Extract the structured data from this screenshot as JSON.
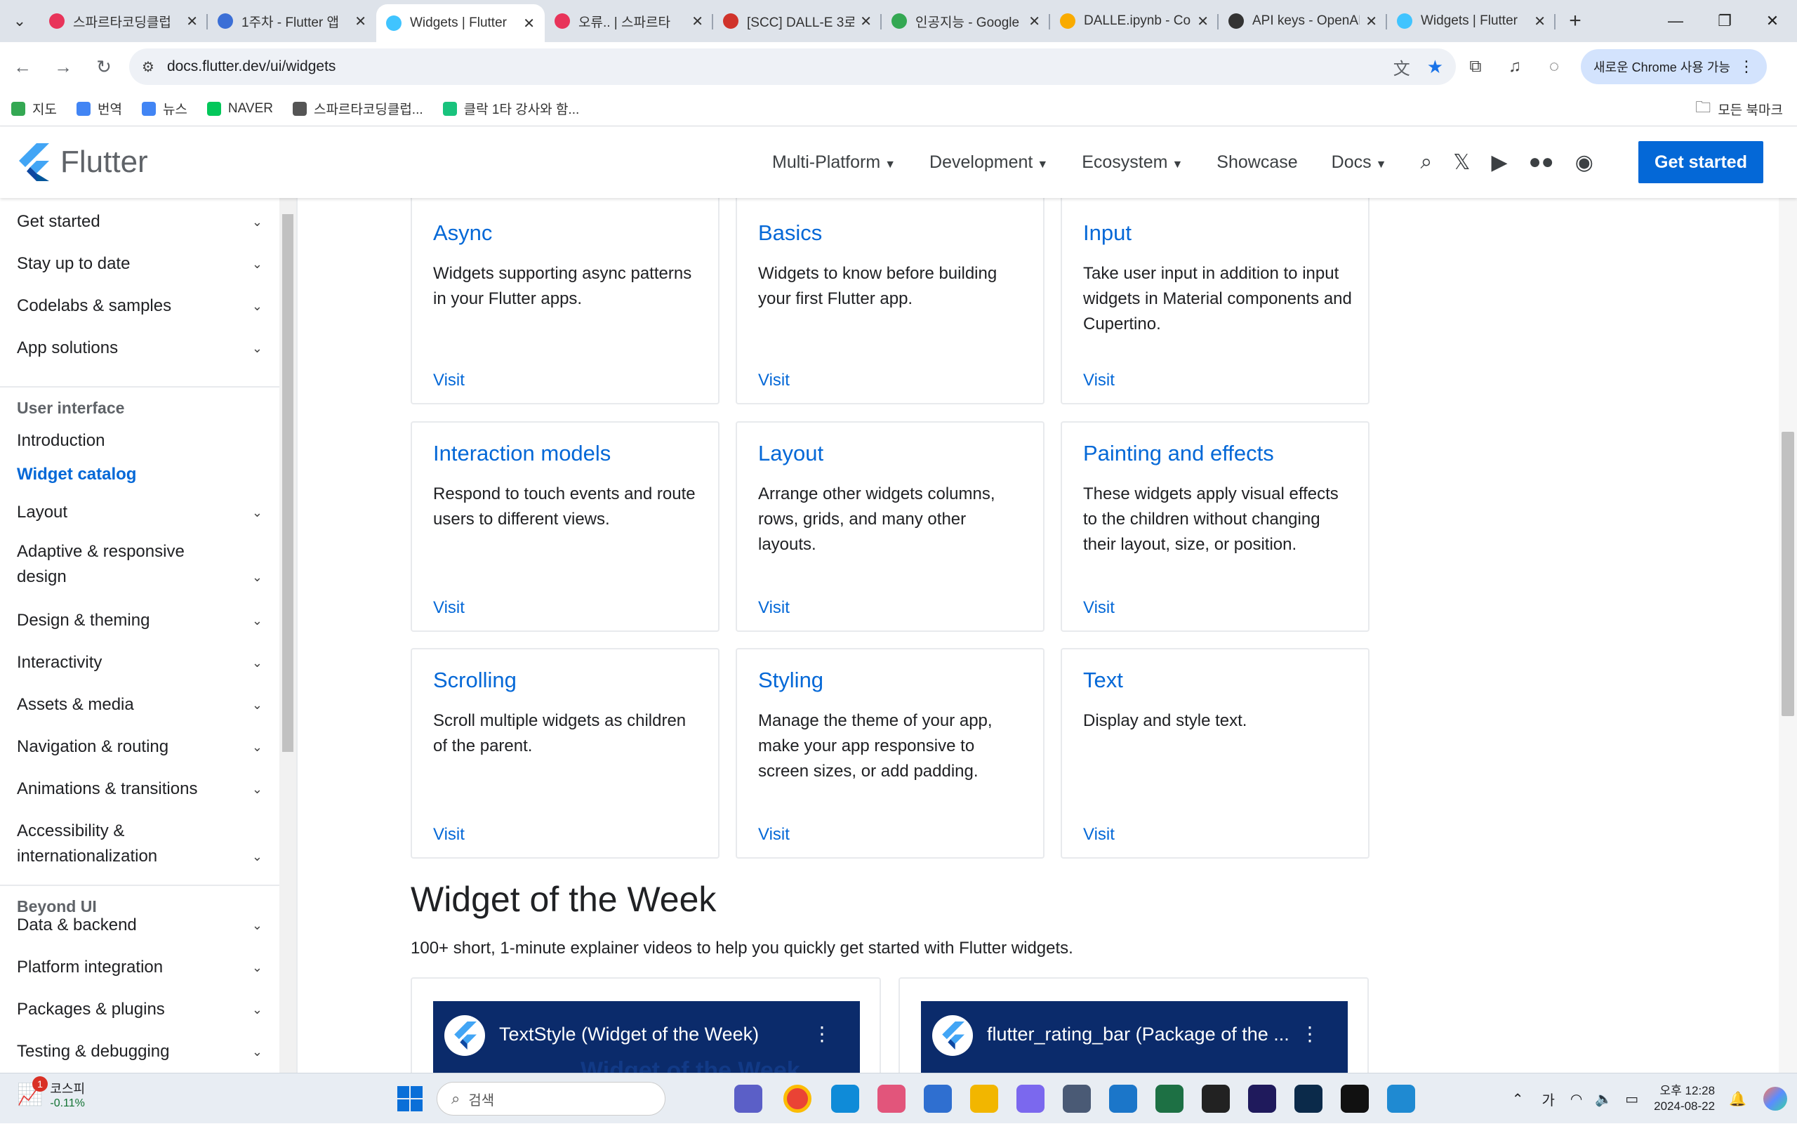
{
  "browser": {
    "tabs": [
      {
        "title": "스파르타코딩클럽",
        "color": "#e8345a"
      },
      {
        "title": "1주차 - Flutter 앱",
        "color": "#3b6fd6"
      },
      {
        "title": "Widgets | Flutter",
        "color": "#40c4ff",
        "active": true
      },
      {
        "title": "오류.. | 스파르타",
        "color": "#e8345a"
      },
      {
        "title": "[SCC] DALL-E 3로",
        "color": "#d0332b"
      },
      {
        "title": "인공지능 - Google",
        "color": "#34a853"
      },
      {
        "title": "DALLE.ipynb - Colab",
        "color": "#f9ab00"
      },
      {
        "title": "API keys - OpenAI",
        "color": "#333333"
      },
      {
        "title": "Widgets | Flutter",
        "color": "#40c4ff"
      }
    ],
    "url": "docs.flutter.dev/ui/widgets",
    "chrome_update": "새로운 Chrome 사용 가능",
    "bookmarks": [
      {
        "label": "지도",
        "color": "#34a853"
      },
      {
        "label": "번역",
        "color": "#4285f4"
      },
      {
        "label": "뉴스",
        "color": "#4285f4"
      },
      {
        "label": "NAVER",
        "color": "#03c75a"
      },
      {
        "label": "스파르타코딩클럽...",
        "color": "#555555"
      },
      {
        "label": "클락 1타 강사와 함...",
        "color": "#19c37d"
      }
    ],
    "all_bookmarks": "모든 북마크"
  },
  "header": {
    "brand": "Flutter",
    "nav": [
      "Multi-Platform",
      "Development",
      "Ecosystem",
      "Showcase",
      "Docs"
    ],
    "nav_dropdown": [
      true,
      true,
      true,
      false,
      true
    ],
    "cta": "Get started"
  },
  "sidebar": {
    "top_items": [
      "Get started",
      "Stay up to date",
      "Codelabs & samples",
      "App solutions"
    ],
    "ui_heading": "User interface",
    "ui_links": [
      "Introduction",
      "Widget catalog"
    ],
    "ui_items": [
      "Layout",
      "Adaptive & responsive design",
      "Design & theming",
      "Interactivity",
      "Assets & media",
      "Navigation & routing",
      "Animations & transitions",
      "Accessibility & internationalization"
    ],
    "beyond_heading": "Beyond UI",
    "beyond_items": [
      "Data & backend",
      "Platform integration",
      "Packages & plugins",
      "Testing & debugging"
    ]
  },
  "catalog": {
    "visit_label": "Visit",
    "cards": [
      {
        "title": "Async",
        "desc": "Widgets supporting async patterns in your Flutter apps."
      },
      {
        "title": "Basics",
        "desc": "Widgets to know before building your first Flutter app."
      },
      {
        "title": "Input",
        "desc": "Take user input in addition to input widgets in Material components and Cupertino."
      },
      {
        "title": "Interaction models",
        "desc": "Respond to touch events and route users to different views."
      },
      {
        "title": "Layout",
        "desc": "Arrange other widgets columns, rows, grids, and many other layouts."
      },
      {
        "title": "Painting and effects",
        "desc": "These widgets apply visual effects to the children without changing their layout, size, or position."
      },
      {
        "title": "Scrolling",
        "desc": "Scroll multiple widgets as children of the parent."
      },
      {
        "title": "Styling",
        "desc": "Manage the theme of your app, make your app responsive to screen sizes, or add padding."
      },
      {
        "title": "Text",
        "desc": "Display and style text."
      }
    ]
  },
  "wotw": {
    "title": "Widget of the Week",
    "desc": "100+ short, 1-minute explainer videos to help you quickly get started with Flutter widgets.",
    "videos": [
      {
        "title": "TextStyle (Widget of the Week)",
        "subtitle": "Widget of the Week"
      },
      {
        "title": "flutter_rating_bar (Package of the ...",
        "subtitle": ""
      }
    ]
  },
  "taskbar": {
    "widget_name": "코스피",
    "widget_value": "-0.11%",
    "badge": "1",
    "search": "검색",
    "ime": "가",
    "time": "오후 12:28",
    "date": "2024-08-22"
  }
}
